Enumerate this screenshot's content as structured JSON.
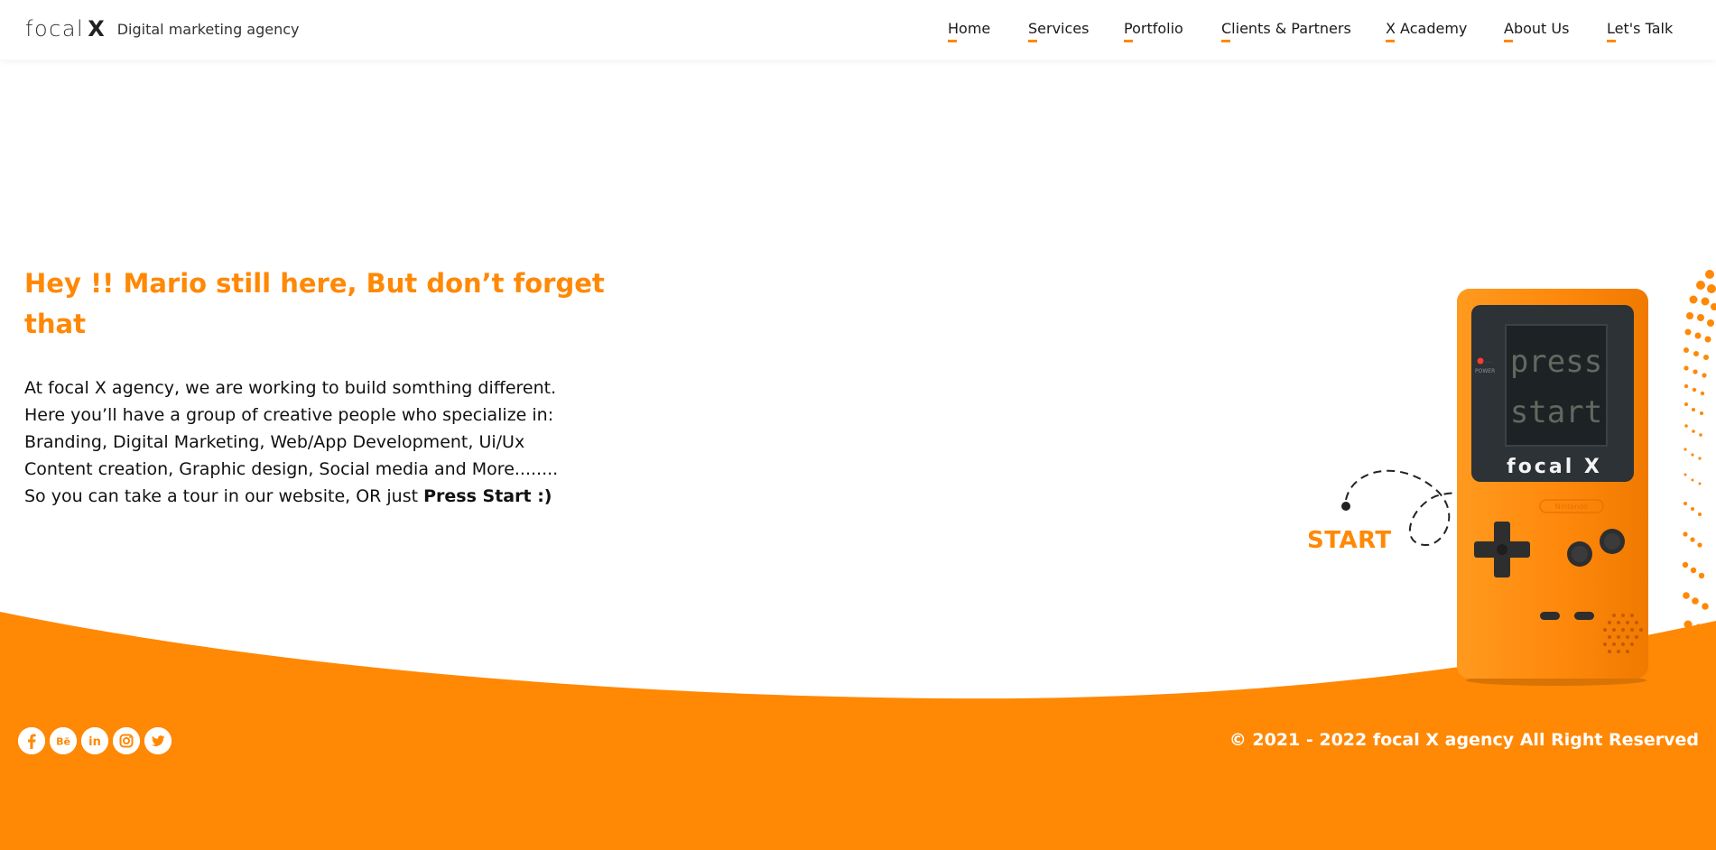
{
  "header": {
    "logo_word": "focal",
    "logo_x": "X",
    "tagline": "Digital marketing agency"
  },
  "nav": {
    "items": [
      {
        "label": "Home"
      },
      {
        "label": "Services"
      },
      {
        "label": "Portfolio"
      },
      {
        "label": "Clients & Partners"
      },
      {
        "label": "X Academy"
      },
      {
        "label": "About Us"
      },
      {
        "label": "Let's Talk"
      }
    ]
  },
  "hero": {
    "title": "Hey !! Mario still here, But don’t forget that",
    "body_lines": [
      "At focal X agency, we are working to build somthing different.",
      "Here you’ll have a group of creative people who specialize in:",
      "Branding, Digital Marketing, Web/App Development, Ui/Ux",
      "Content creation, Graphic design, Social media and More........",
      "So you can take a tour in our website, OR just "
    ],
    "cta_bold": "Press Start :)"
  },
  "gameboy": {
    "screen_line1": "press",
    "screen_line2": "start",
    "brand": "focal X",
    "power_label": "POWER",
    "nintendo_label": "Nintendo",
    "start_label": "START"
  },
  "footer": {
    "social_icons": [
      "facebook-icon",
      "behance-icon",
      "linkedin-icon",
      "instagram-icon",
      "twitter-icon"
    ],
    "copyright": "© 2021 - 2022 focal X agency All Right Reserved"
  },
  "colors": {
    "accent": "#ff8805",
    "text": "#111111",
    "background": "#ffffff"
  }
}
